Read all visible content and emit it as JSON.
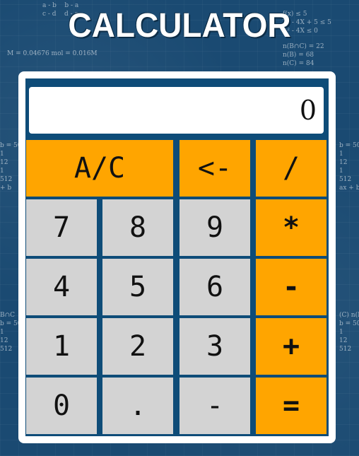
{
  "title": "CALCULATOR",
  "display": {
    "value": "0"
  },
  "buttons": {
    "clear": "A/C",
    "backspace": "<-",
    "divide": "/",
    "seven": "7",
    "eight": "8",
    "nine": "9",
    "multiply": "*",
    "four": "4",
    "five": "5",
    "six": "6",
    "minus": "-",
    "one": "1",
    "two": "2",
    "three": "3",
    "plus": "+",
    "zero": "0",
    "decimal": ".",
    "negate": "-",
    "equals": "="
  },
  "colors": {
    "background": "#1a4a72",
    "frame": "#0e4c78",
    "number_key": "#d3d3d3",
    "operator_key": "#ffa500"
  }
}
